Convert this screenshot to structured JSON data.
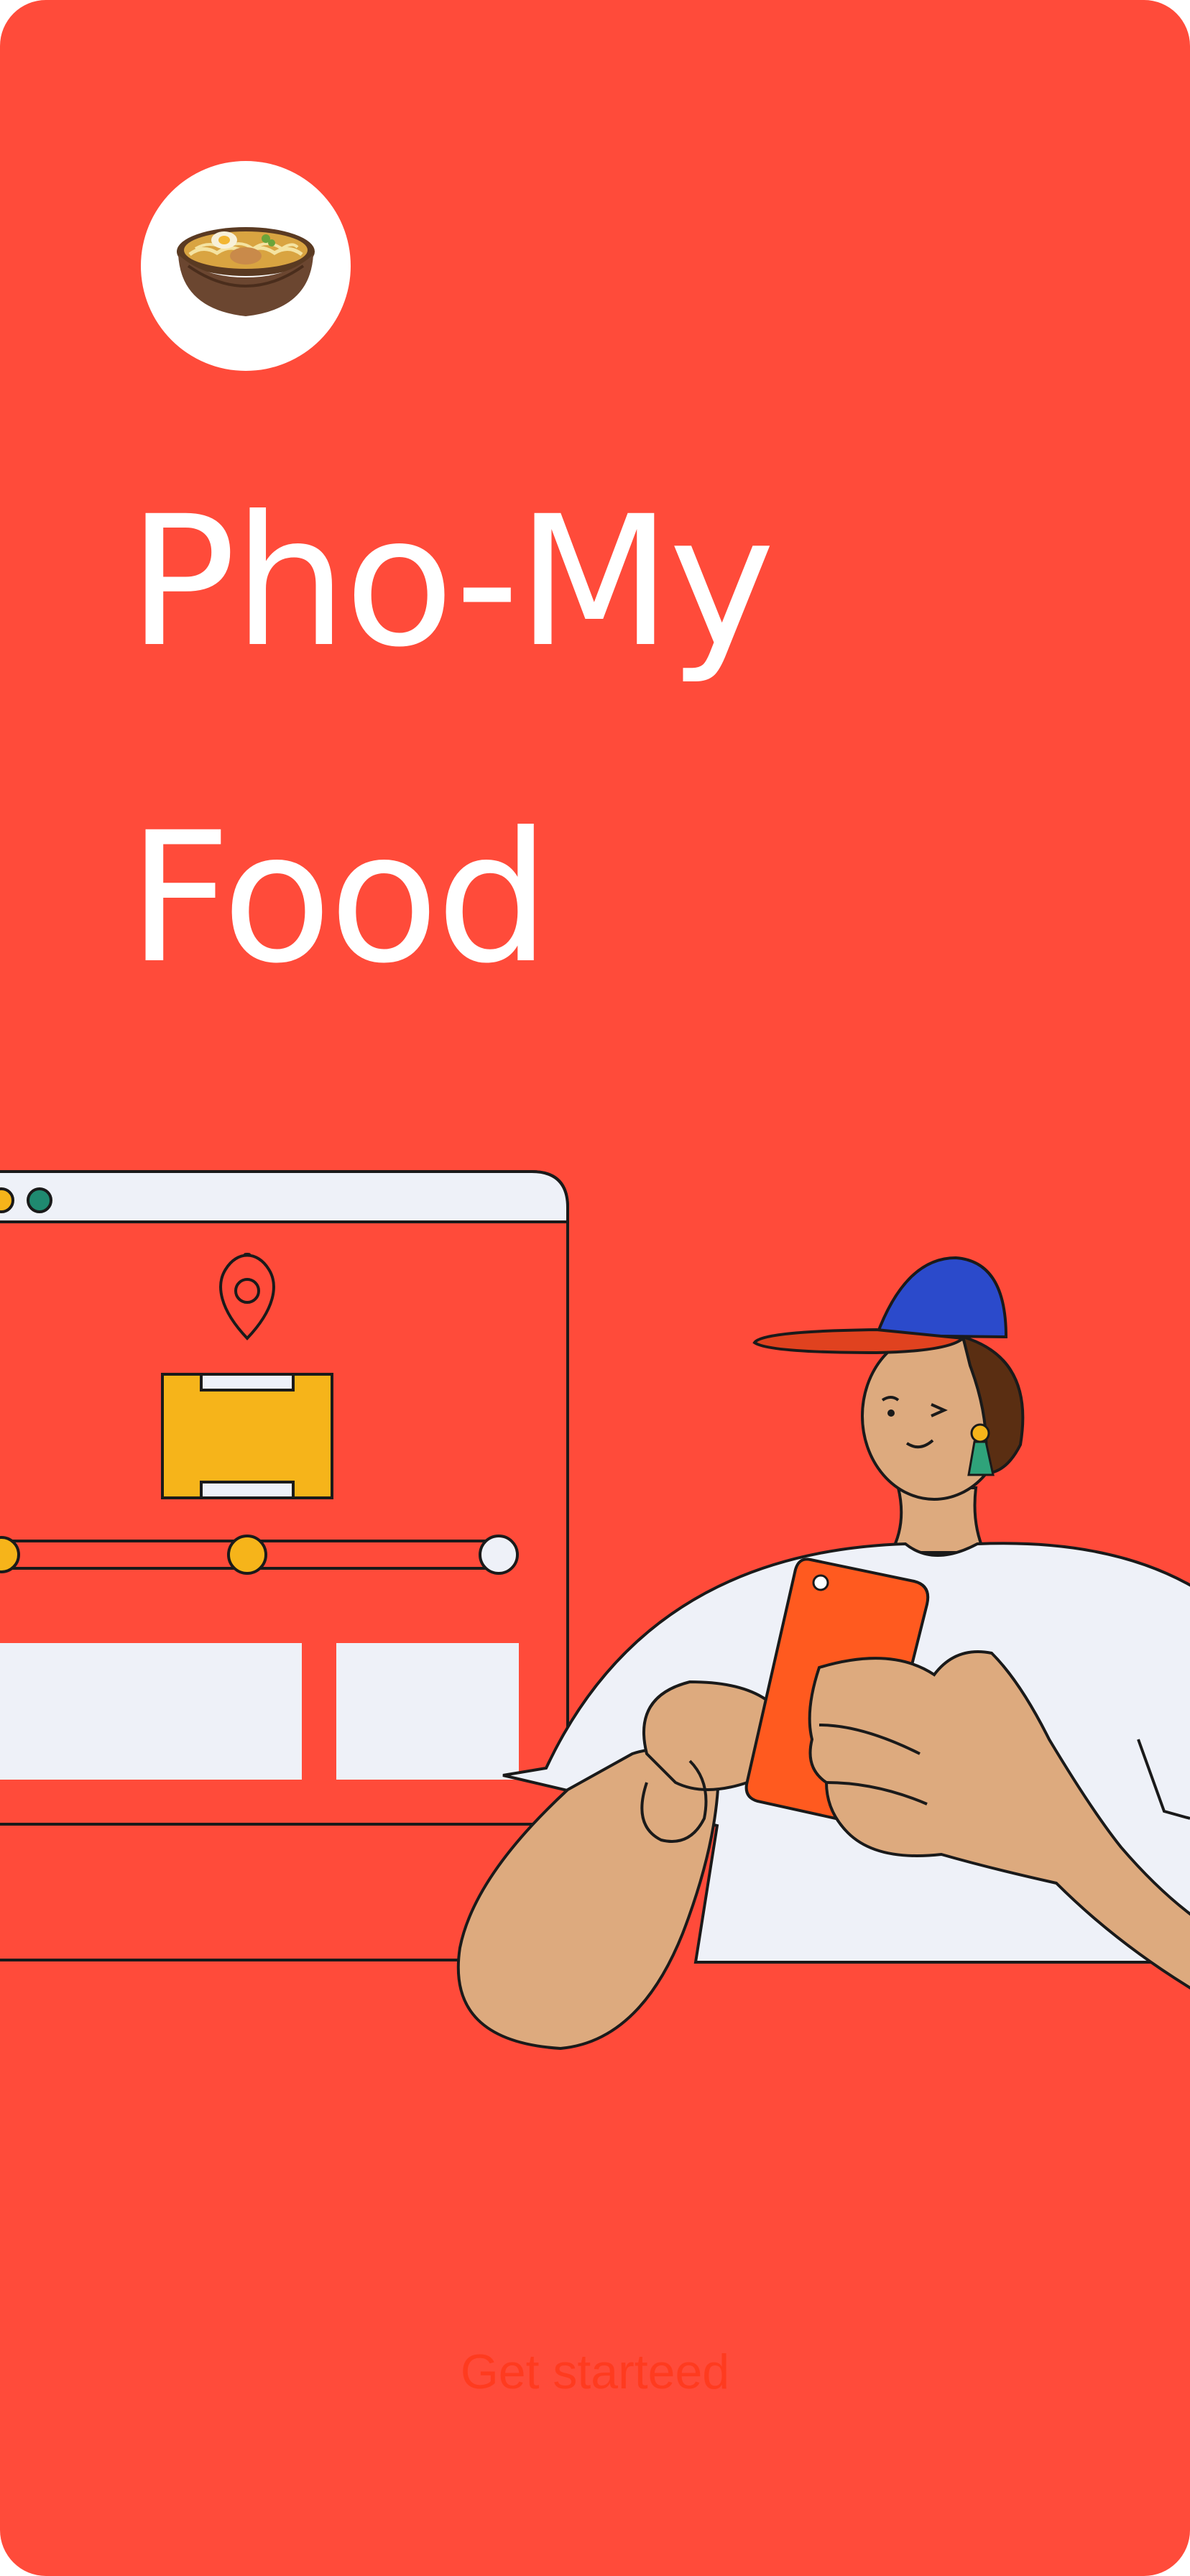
{
  "app": {
    "title_line1": "Pho-My",
    "title_line2": "Food",
    "logo_icon": "pho-bowl-icon"
  },
  "onboarding": {
    "cta_label": "Get starteed"
  },
  "colors": {
    "background": "#FF4B3A",
    "cta_text": "#FF3B1F",
    "title_text": "#FFFFFF"
  },
  "illustration": {
    "subject": "delivery-person-with-phone-and-tracking-window"
  }
}
